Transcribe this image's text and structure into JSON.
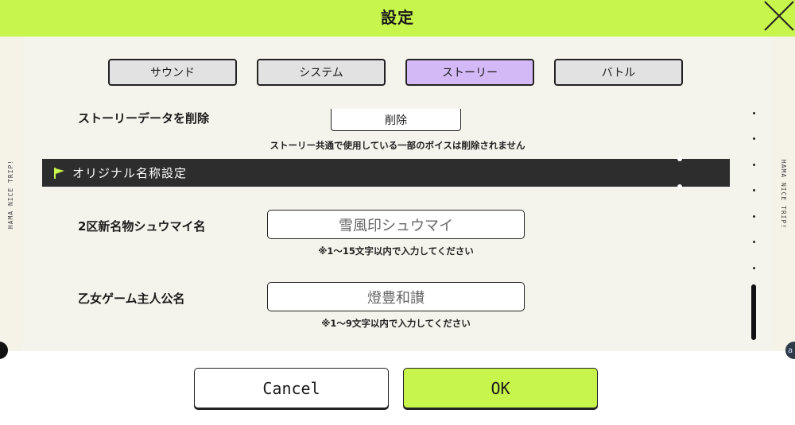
{
  "header": {
    "title": "設定"
  },
  "side": {
    "left_text": "HAMA NICE TRIP!",
    "right_text": "HAMA NICE TRIP!"
  },
  "tabs": [
    {
      "label": "サウンド",
      "active": false
    },
    {
      "label": "システム",
      "active": false
    },
    {
      "label": "ストーリー",
      "active": true
    },
    {
      "label": "バトル",
      "active": false
    }
  ],
  "story_data": {
    "label": "ストーリーデータを削除",
    "button_label": "削除",
    "note": "ストーリー共通で使用している一部のボイスは削除されません"
  },
  "section": {
    "title": "オリジナル名称設定"
  },
  "fields": [
    {
      "label": "2区新名物シュウマイ名",
      "value": "雪風印シュウマイ",
      "hint": "※1〜15文字以内で入力してください"
    },
    {
      "label": "乙女ゲーム主人公名",
      "value": "燈豊和讃",
      "hint": "※1〜9文字以内で入力してください"
    }
  ],
  "footer": {
    "cancel_label": "Cancel",
    "ok_label": "OK"
  },
  "colors": {
    "accent": "#c8f54b",
    "active_tab": "#d4b9f7",
    "section_bar": "#2d2d2d",
    "panel": "#f5f4ec"
  }
}
